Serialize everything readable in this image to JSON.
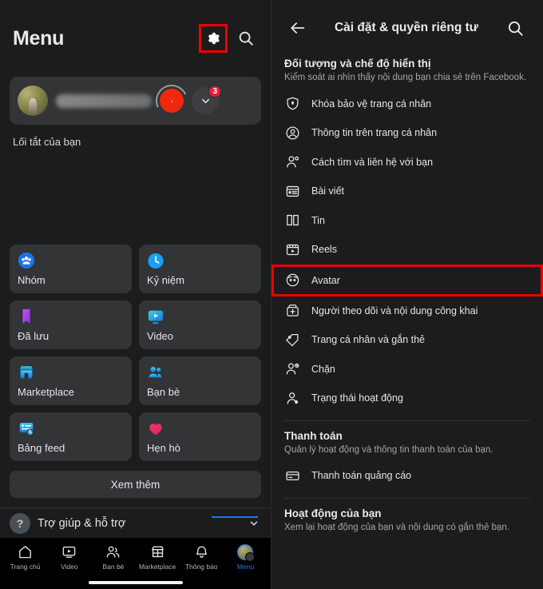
{
  "left": {
    "header": {
      "title": "Menu",
      "settings_icon": "gear-icon",
      "search_icon": "search-icon",
      "settings_highlight_color": "#ee0000"
    },
    "profile": {
      "avatar": "user-avatar",
      "name_hidden": true,
      "status_badge_icon": "orange-circle-badge",
      "notification_count": "3",
      "expand_icon": "chevron-down-icon"
    },
    "shortcut_label": "Lối tắt của bạn",
    "tiles": [
      {
        "label": "Nhóm",
        "icon": "groups-icon",
        "color": "#1b74e4"
      },
      {
        "label": "Kỷ niệm",
        "icon": "memories-clock-icon",
        "color": "#1b9ef4"
      },
      {
        "label": "Đã lưu",
        "icon": "saved-bookmark-icon",
        "color": "#c24bd6"
      },
      {
        "label": "Video",
        "icon": "video-icon",
        "color": "#2ab3d6"
      },
      {
        "label": "Marketplace",
        "icon": "marketplace-store-icon",
        "color": "#2aa8e0"
      },
      {
        "label": "Bạn bè",
        "icon": "friends-icon",
        "color": "#1b9ef4"
      },
      {
        "label": "Bảng feed",
        "icon": "feeds-icon",
        "color": "#2aa8e0"
      },
      {
        "label": "Hẹn hò",
        "icon": "dating-heart-icon",
        "color": "#f0356a"
      }
    ],
    "see_more_label": "Xem thêm",
    "help": {
      "label": "Trợ giúp & hỗ trợ",
      "icon": "question-mark-icon",
      "chevron": "chevron-down-icon",
      "accent_color": "#1877f2"
    },
    "bottom_nav": {
      "active_index": 5,
      "items": [
        {
          "label": "Trang chủ",
          "icon": "home-icon"
        },
        {
          "label": "Video",
          "icon": "video-play-icon"
        },
        {
          "label": "Bạn bè",
          "icon": "friends-icon"
        },
        {
          "label": "Marketplace",
          "icon": "marketplace-icon"
        },
        {
          "label": "Thông báo",
          "icon": "bell-icon"
        },
        {
          "label": "Menu",
          "icon": "menu-avatar-icon"
        }
      ]
    }
  },
  "right": {
    "header": {
      "back_icon": "back-arrow-icon",
      "title": "Cài đặt & quyền riêng tư",
      "search_icon": "search-icon"
    },
    "sections": [
      {
        "title": "Đối tượng và chế độ hiển thị",
        "subtitle": "Kiểm soát ai nhìn thấy nội dung bạn chia sẻ trên Facebook.",
        "items": [
          {
            "label": "Khóa bảo vệ trang cá nhân",
            "icon": "shield-lock-icon",
            "highlighted": false
          },
          {
            "label": "Thông tin trên trang cá nhân",
            "icon": "profile-circle-icon",
            "highlighted": false
          },
          {
            "label": "Cách tìm và liên hệ với bạn",
            "icon": "person-search-icon",
            "highlighted": false
          },
          {
            "label": "Bài viết",
            "icon": "posts-icon",
            "highlighted": false
          },
          {
            "label": "Tin",
            "icon": "stories-book-icon",
            "highlighted": false
          },
          {
            "label": "Reels",
            "icon": "reels-icon",
            "highlighted": false
          },
          {
            "label": "Avatar",
            "icon": "avatar-face-icon",
            "highlighted": true
          },
          {
            "label": "Người theo dõi và nội dung công khai",
            "icon": "followers-add-icon",
            "highlighted": false
          },
          {
            "label": "Trang cá nhân và gắn thẻ",
            "icon": "tag-icon",
            "highlighted": false
          },
          {
            "label": "Chặn",
            "icon": "block-person-icon",
            "highlighted": false
          },
          {
            "label": "Trạng thái hoạt động",
            "icon": "active-status-icon",
            "highlighted": false
          }
        ]
      },
      {
        "title": "Thanh toán",
        "subtitle": "Quản lý hoạt động và thông tin thanh toán của bạn.",
        "items": [
          {
            "label": "Thanh toán quảng cáo",
            "icon": "credit-card-icon",
            "highlighted": false
          }
        ]
      },
      {
        "title": "Hoạt động của bạn",
        "subtitle": "Xem lại hoạt động của bạn và nội dung có gắn thẻ bạn.",
        "items": []
      }
    ],
    "highlight_color": "#ee0000"
  }
}
